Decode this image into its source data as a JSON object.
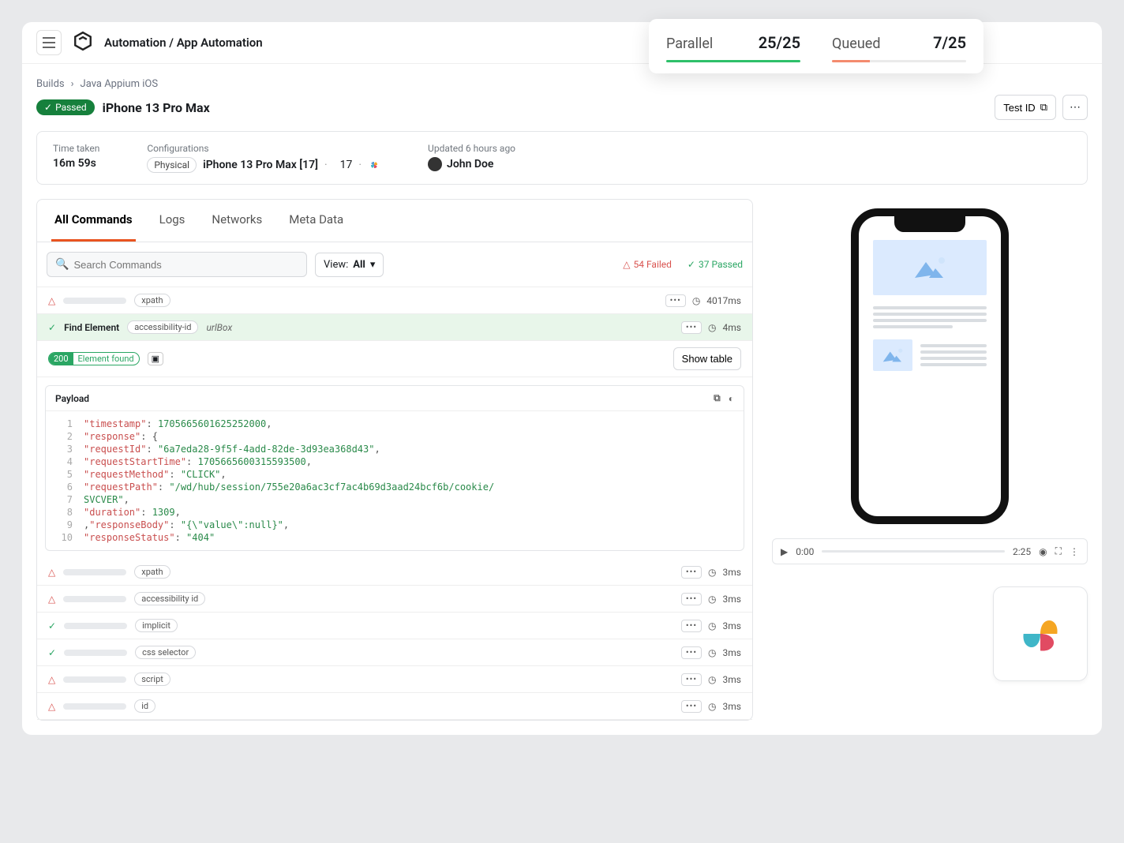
{
  "header": {
    "title": "Automation / App Automation"
  },
  "stats": {
    "parallel": {
      "label": "Parallel",
      "value": "25/25",
      "fill": 100,
      "color": "#2ec06a"
    },
    "queued": {
      "label": "Queued",
      "value": "7/25",
      "fill": 28,
      "color": "#f48b6e"
    }
  },
  "breadcrumb": {
    "root": "Builds",
    "leaf": "Java Appium iOS"
  },
  "status_badge": "Passed",
  "page_title": "iPhone 13 Pro Max",
  "actions": {
    "test_id": "Test ID"
  },
  "info": {
    "time_taken_label": "Time taken",
    "time_taken": "16m 59s",
    "config_label": "Configurations",
    "physical": "Physical",
    "device": "iPhone 13 Pro Max [17]",
    "os_version": "17",
    "updated": "Updated 6 hours ago",
    "user": "John Doe"
  },
  "tabs": [
    "All Commands",
    "Logs",
    "Networks",
    "Meta Data"
  ],
  "filter": {
    "search_placeholder": "Search Commands",
    "view_prefix": "View: ",
    "view_value": "All",
    "failed": "54 Failed",
    "passed": "37 Passed"
  },
  "rows": [
    {
      "status": "fail",
      "tag": "xpath",
      "time": "4017ms"
    },
    {
      "status": "pass",
      "name": "Find Element",
      "tag": "accessibility-id",
      "extra": "urlBox",
      "time": "4ms",
      "expanded": true
    },
    {
      "status": "fail",
      "tag": "xpath",
      "time": "3ms"
    },
    {
      "status": "fail",
      "tag": "accessibility id",
      "time": "3ms"
    },
    {
      "status": "pass",
      "tag": "implicit",
      "time": "3ms"
    },
    {
      "status": "pass",
      "tag": "css selector",
      "time": "3ms"
    },
    {
      "status": "fail",
      "tag": "script",
      "time": "3ms"
    },
    {
      "status": "fail",
      "tag": "id",
      "time": "3ms"
    }
  ],
  "expanded_detail": {
    "code": "200",
    "found": "Element found",
    "show_table": "Show table",
    "payload_title": "Payload"
  },
  "payload_lines": [
    [
      {
        "t": "k",
        "v": "\"timestamp\""
      },
      {
        "t": "p",
        "v": ": "
      },
      {
        "t": "n",
        "v": "1705665601625252000"
      },
      {
        "t": "p",
        "v": ","
      }
    ],
    [
      {
        "t": "p",
        "v": "    "
      },
      {
        "t": "k",
        "v": "\"response\""
      },
      {
        "t": "p",
        "v": ": {"
      }
    ],
    [
      {
        "t": "p",
        "v": "        "
      },
      {
        "t": "k",
        "v": "\"requestId\""
      },
      {
        "t": "p",
        "v": ": "
      },
      {
        "t": "s",
        "v": "\"6a7eda28-9f5f-4add-82de-3d93ea368d43\""
      },
      {
        "t": "p",
        "v": ","
      }
    ],
    [
      {
        "t": "p",
        "v": "        "
      },
      {
        "t": "k",
        "v": "\"requestStartTime\""
      },
      {
        "t": "p",
        "v": ": "
      },
      {
        "t": "n",
        "v": "1705665600315593500"
      },
      {
        "t": "p",
        "v": ","
      }
    ],
    [
      {
        "t": "p",
        "v": "        "
      },
      {
        "t": "k",
        "v": "\"requestMethod\""
      },
      {
        "t": "p",
        "v": ": "
      },
      {
        "t": "s",
        "v": "\"CLICK\""
      },
      {
        "t": "p",
        "v": ","
      }
    ],
    [
      {
        "t": "p",
        "v": "        "
      },
      {
        "t": "k",
        "v": "\"requestPath\""
      },
      {
        "t": "p",
        "v": ": "
      },
      {
        "t": "s",
        "v": "\"/wd/hub/session/755e20a6ac3cf7ac4b69d3aad24bcf6b/cookie/"
      }
    ],
    [
      {
        "t": "s",
        "v": "                    SVCVER\""
      },
      {
        "t": "p",
        "v": ","
      }
    ],
    [
      {
        "t": "p",
        "v": "        "
      },
      {
        "t": "k",
        "v": "\"duration\""
      },
      {
        "t": "p",
        "v": ": "
      },
      {
        "t": "n",
        "v": "1309"
      },
      {
        "t": "p",
        "v": ","
      }
    ],
    [
      {
        "t": "p",
        "v": "        ,"
      },
      {
        "t": "k",
        "v": "\"responseBody\""
      },
      {
        "t": "p",
        "v": ": "
      },
      {
        "t": "s",
        "v": "\"{\\\"value\\\":null}\""
      },
      {
        "t": "p",
        "v": ","
      }
    ],
    [
      {
        "t": "p",
        "v": "        "
      },
      {
        "t": "k",
        "v": "\"responseStatus\""
      },
      {
        "t": "p",
        "v": ": "
      },
      {
        "t": "s",
        "v": "\"404\""
      }
    ]
  ],
  "video": {
    "current": "0:00",
    "total": "2:25"
  }
}
